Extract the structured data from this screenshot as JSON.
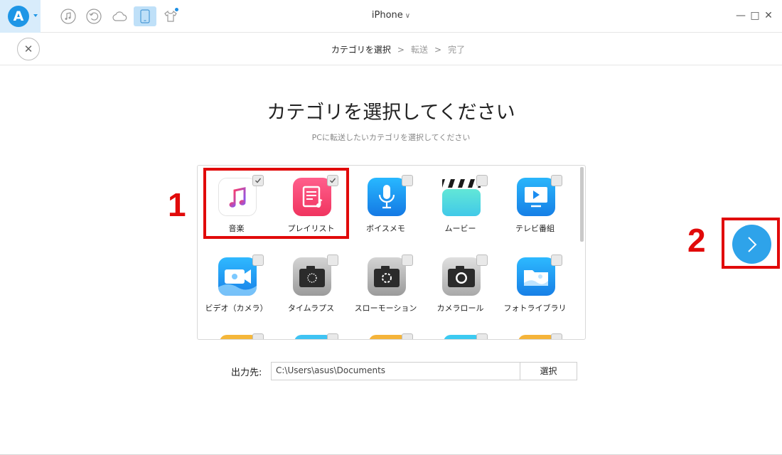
{
  "titlebar": {
    "device_name": "iPhone",
    "logo_letter": "A",
    "icons": [
      "music-note-icon",
      "restore-icon",
      "cloud-icon",
      "phone-icon",
      "tshirt-icon"
    ],
    "window_controls": [
      "minimize-icon",
      "maximize-icon",
      "close-icon"
    ]
  },
  "steps": {
    "items": [
      "カテゴリを選択",
      "転送",
      "完了"
    ],
    "separator": ">",
    "active_index": 0
  },
  "main": {
    "title": "カテゴリを選択してください",
    "subtitle": "PCに転送したいカテゴリを選択してください"
  },
  "categories": [
    {
      "label": "音楽",
      "icon": "music-icon",
      "checked": true
    },
    {
      "label": "プレイリスト",
      "icon": "playlist-icon",
      "checked": true
    },
    {
      "label": "ボイスメモ",
      "icon": "voice-memo-icon",
      "checked": false
    },
    {
      "label": "ムービー",
      "icon": "movie-icon",
      "checked": false
    },
    {
      "label": "テレビ番組",
      "icon": "tv-icon",
      "checked": false
    },
    {
      "label": "ビデオ（カメラ）",
      "icon": "video-camera-icon",
      "checked": false
    },
    {
      "label": "タイムラプス",
      "icon": "timelapse-icon",
      "checked": false
    },
    {
      "label": "スローモーション",
      "icon": "slow-motion-icon",
      "checked": false
    },
    {
      "label": "カメラロール",
      "icon": "camera-roll-icon",
      "checked": false
    },
    {
      "label": "フォトライブラリ",
      "icon": "photo-library-icon",
      "checked": false
    }
  ],
  "output": {
    "label": "出力先:",
    "path": "C:\\Users\\asus\\Documents",
    "select_button": "選択"
  },
  "annotations": {
    "marker_1": "1",
    "marker_2": "2"
  },
  "colors": {
    "accent": "#2ea3ea",
    "annotation_red": "#e10a0a",
    "device_button_bg": "#bfe0f8"
  }
}
